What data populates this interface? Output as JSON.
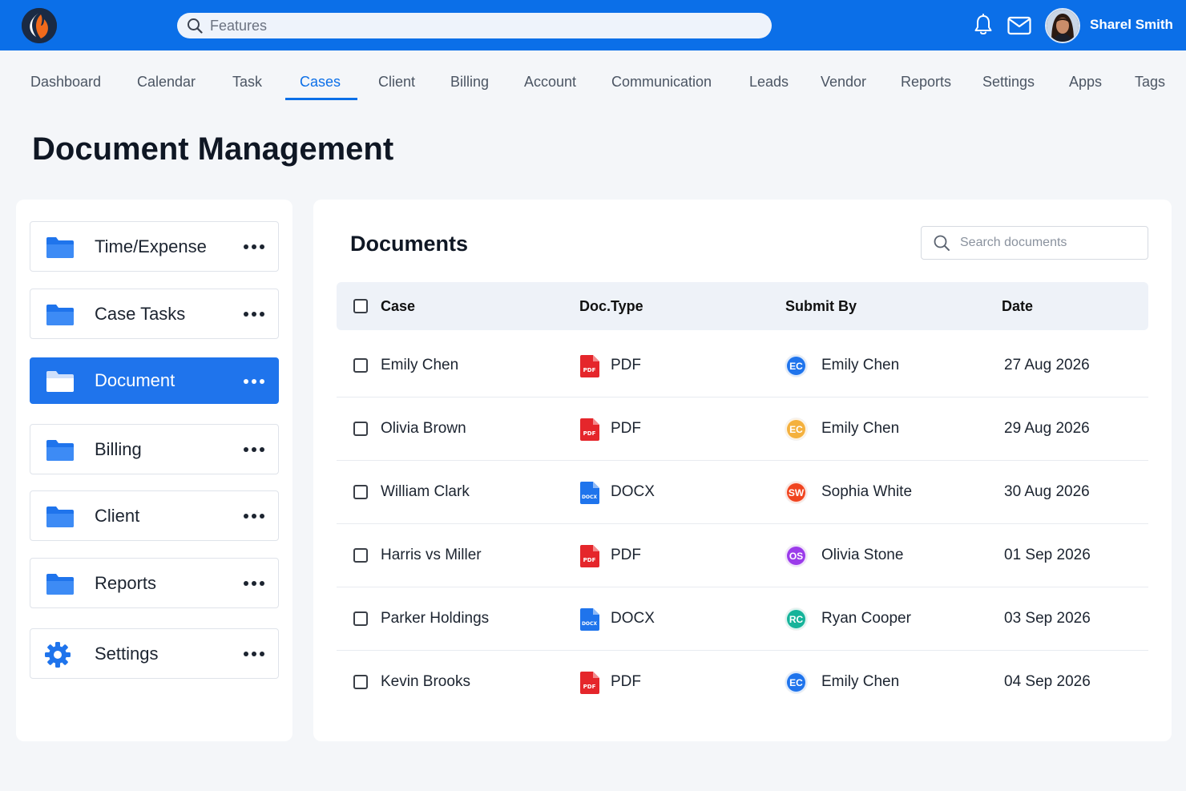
{
  "topbar": {
    "search_placeholder": "Features",
    "user_name": "Sharel Smith",
    "icons": [
      "logo-icon",
      "search-icon",
      "bell-icon",
      "mail-icon",
      "avatar"
    ]
  },
  "nav": {
    "tabs": [
      {
        "label": "Dashboard"
      },
      {
        "label": "Calendar"
      },
      {
        "label": "Task"
      },
      {
        "label": "Cases",
        "active": true
      },
      {
        "label": "Client"
      },
      {
        "label": "Billing"
      },
      {
        "label": "Account"
      },
      {
        "label": "Communication"
      },
      {
        "label": "Leads"
      },
      {
        "label": "Vendor"
      },
      {
        "label": "Reports"
      },
      {
        "label": "Settings"
      },
      {
        "label": "Apps"
      },
      {
        "label": "Tags"
      }
    ]
  },
  "page": {
    "title": "Document Management"
  },
  "sidebar": {
    "items": [
      {
        "label": "Time/Expense",
        "icon": "folder-icon"
      },
      {
        "label": "Case Tasks",
        "icon": "folder-icon"
      },
      {
        "label": "Document",
        "icon": "folder-icon",
        "active": true
      },
      {
        "label": "Billing",
        "icon": "folder-icon"
      },
      {
        "label": "Client",
        "icon": "folder-icon"
      },
      {
        "label": "Reports",
        "icon": "folder-icon"
      },
      {
        "label": "Settings",
        "icon": "gear-icon"
      }
    ]
  },
  "documents": {
    "title": "Documents",
    "search_placeholder": "Search documents",
    "columns": {
      "case": "Case",
      "doc_type": "Doc.Type",
      "submit_by": "Submit By",
      "date": "Date"
    },
    "rows": [
      {
        "case": "Emily Chen",
        "doc_type": "PDF",
        "initials": "EC",
        "badge_color": "#1f74ec",
        "submit_by": "Emily Chen",
        "date": "27 Aug 2026"
      },
      {
        "case": "Olivia Brown",
        "doc_type": "PDF",
        "initials": "EC",
        "badge_color": "#f4b13e",
        "submit_by": "Emily Chen",
        "date": "29 Aug 2026"
      },
      {
        "case": "William Clark",
        "doc_type": "DOCX",
        "initials": "SW",
        "badge_color": "#f0441f",
        "submit_by": "Sophia White",
        "date": "30 Aug 2026"
      },
      {
        "case": "Harris vs Miller",
        "doc_type": "PDF",
        "initials": "OS",
        "badge_color": "#9b3bea",
        "submit_by": "Olivia Stone",
        "date": "01 Sep 2026"
      },
      {
        "case": "Parker Holdings",
        "doc_type": "DOCX",
        "initials": "RC",
        "badge_color": "#16b39a",
        "submit_by": "Ryan Cooper",
        "date": "03 Sep 2026"
      },
      {
        "case": "Kevin Brooks",
        "doc_type": "PDF",
        "initials": "EC",
        "badge_color": "#1f74ec",
        "submit_by": "Emily Chen",
        "date": "04 Sep 2026"
      }
    ]
  },
  "colors": {
    "brand": "#0b6fe8",
    "pdf": "#e5262b",
    "docx": "#1f74ec"
  }
}
